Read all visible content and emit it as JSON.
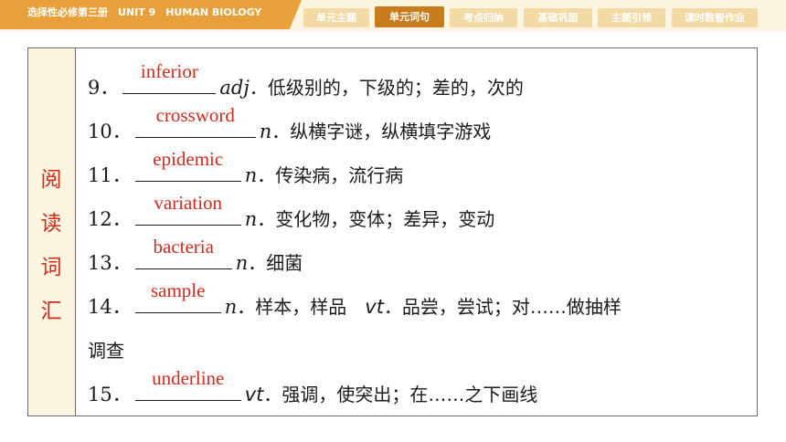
{
  "header": {
    "course_title": "选择性必修第三册　UNIT 9　HUMAN BIOLOGY",
    "tabs": [
      {
        "label": "单元主题",
        "active": false
      },
      {
        "label": "单元词句",
        "active": true
      },
      {
        "label": "考点归纳",
        "active": false
      },
      {
        "label": "基础巩固",
        "active": false
      },
      {
        "label": "主题引领",
        "active": false
      },
      {
        "label": "课时数智作业",
        "active": false
      }
    ]
  },
  "section": {
    "label_chars": [
      "阅",
      "读",
      "词",
      "汇"
    ]
  },
  "entries": [
    {
      "num": "9．",
      "answer": "inferior",
      "pos": "adj",
      "meaning": "．低级别的，下级的；差的，次的"
    },
    {
      "num": "10．",
      "answer": "crossword",
      "pos": "n",
      "meaning": "．纵横字谜，纵横填字游戏"
    },
    {
      "num": "11．",
      "answer": "epidemic",
      "pos": "n",
      "meaning": "．传染病，流行病"
    },
    {
      "num": "12．",
      "answer": "variation",
      "pos": "n",
      "meaning": "．变化物，变体；差异，变动"
    },
    {
      "num": "13．",
      "answer": "bacteria",
      "pos": "n",
      "meaning": "．细菌"
    },
    {
      "num": "14．",
      "answer": "sample",
      "pos": "n",
      "meaning": "．样本，样品　",
      "pos2": "vt",
      "meaning2": "．品尝，尝试；对……做抽样",
      "continuation": "调查"
    },
    {
      "num": "15．",
      "answer": "underline",
      "pos": "vt",
      "meaning": "．强调，使突出；在……之下画线"
    }
  ],
  "colors": {
    "accent": "#e8a13a",
    "active_tab": "#c77b1b",
    "answer_red": "#d42a1d",
    "panel_bg": "#fdf5df"
  }
}
